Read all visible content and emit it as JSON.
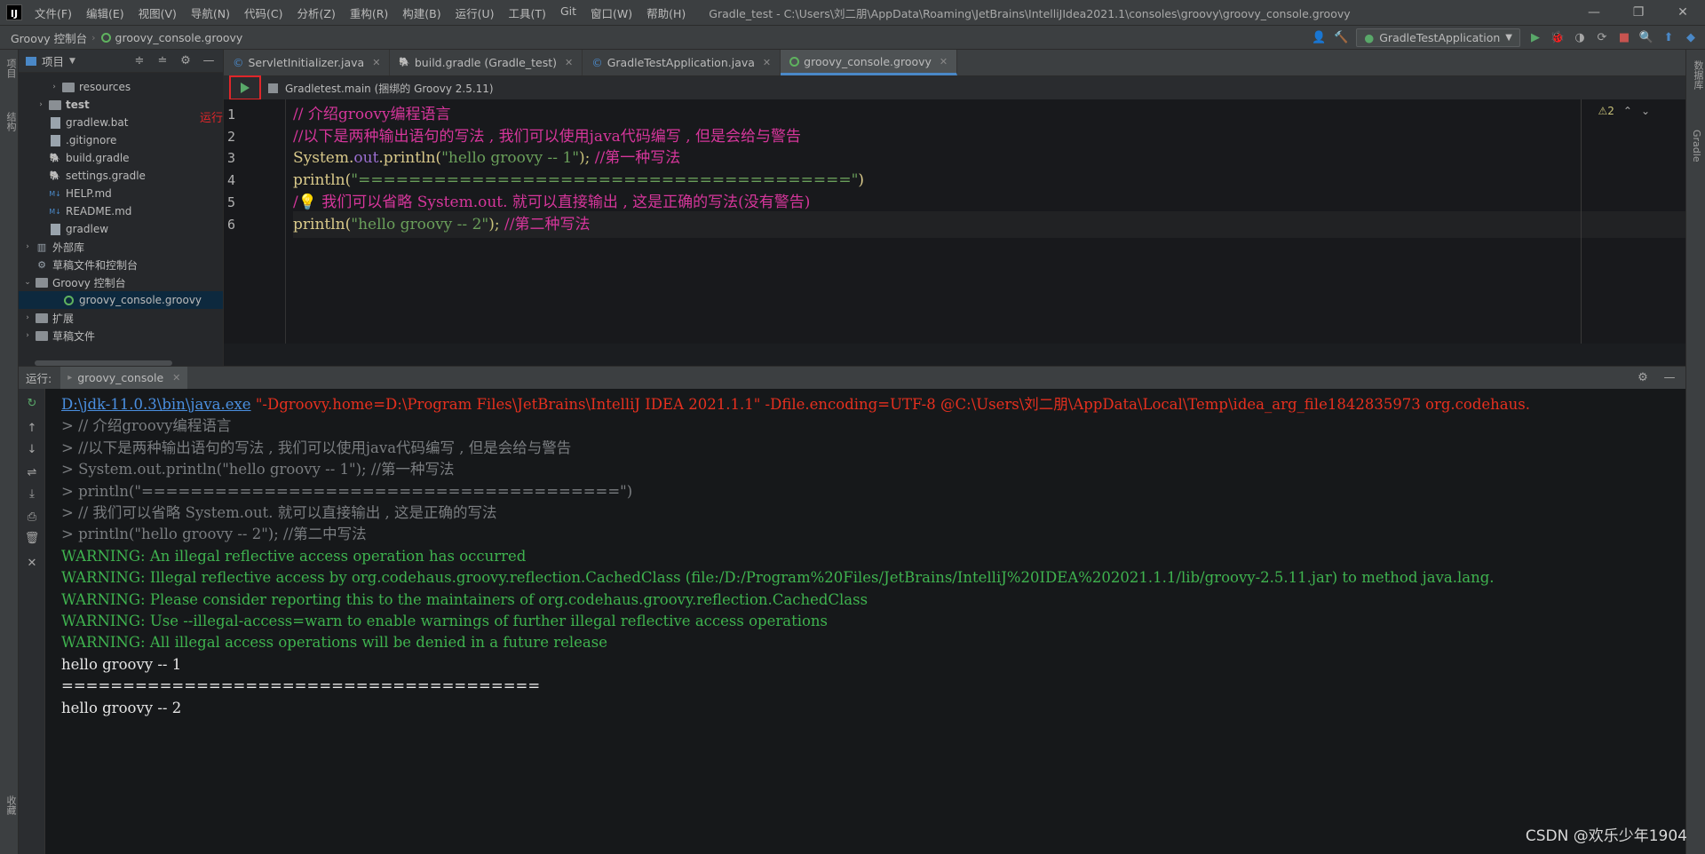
{
  "menu": {
    "items": [
      "文件(F)",
      "编辑(E)",
      "视图(V)",
      "导航(N)",
      "代码(C)",
      "分析(Z)",
      "重构(R)",
      "构建(B)",
      "运行(U)",
      "工具(T)",
      "Git",
      "窗口(W)",
      "帮助(H)"
    ],
    "window_title": "Gradle_test - C:\\Users\\刘二朋\\AppData\\Roaming\\JetBrains\\IntelliJIdea2021.1\\consoles\\groovy\\groovy_console.groovy"
  },
  "nav": {
    "crumb1": "Groovy 控制台",
    "crumb2": "groovy_console.groovy",
    "run_config": "GradleTestApplication"
  },
  "stripe": {
    "left_top": "项目",
    "left_mid": "结构",
    "left_bottom": "收藏",
    "right_top": "数据库",
    "right_mid": "Gradle"
  },
  "project": {
    "header_label": "项目",
    "tree": [
      {
        "label": "resources",
        "indent": 2,
        "arrow": "›",
        "icon": "folder"
      },
      {
        "label": "test",
        "indent": 1,
        "arrow": "›",
        "icon": "folder",
        "bold": true
      },
      {
        "label": "gradlew.bat",
        "indent": 1,
        "arrow": "",
        "icon": "file"
      },
      {
        "label": ".gitignore",
        "indent": 1,
        "arrow": "",
        "icon": "file"
      },
      {
        "label": "build.gradle",
        "indent": 1,
        "arrow": "",
        "icon": "gradle"
      },
      {
        "label": "settings.gradle",
        "indent": 1,
        "arrow": "",
        "icon": "gradle"
      },
      {
        "label": "HELP.md",
        "indent": 1,
        "arrow": "",
        "icon": "md"
      },
      {
        "label": "README.md",
        "indent": 1,
        "arrow": "",
        "icon": "md"
      },
      {
        "label": "gradlew",
        "indent": 1,
        "arrow": "",
        "icon": "file"
      },
      {
        "label": "外部库",
        "indent": 0,
        "arrow": "›",
        "icon": "lib"
      },
      {
        "label": "草稿文件和控制台",
        "indent": 0,
        "arrow": "",
        "icon": "scratch"
      },
      {
        "label": "Groovy 控制台",
        "indent": 0,
        "arrow": "⌄",
        "icon": "folder"
      },
      {
        "label": "groovy_console.groovy",
        "indent": 2,
        "arrow": "",
        "icon": "groovy",
        "selected": true
      },
      {
        "label": "扩展",
        "indent": 0,
        "arrow": "›",
        "icon": "folder"
      },
      {
        "label": "草稿文件",
        "indent": 0,
        "arrow": "›",
        "icon": "folder"
      }
    ]
  },
  "tabs": [
    {
      "label": "ServletInitializer.java",
      "icon": "java"
    },
    {
      "label": "build.gradle (Gradle_test)",
      "icon": "gradle"
    },
    {
      "label": "GradleTestApplication.java",
      "icon": "java"
    },
    {
      "label": "groovy_console.groovy",
      "icon": "groovy",
      "active": true
    }
  ],
  "editor": {
    "run_target": "Gradletest.main (捆绑的 Groovy 2.5.11)",
    "run_annotation": "运行",
    "warning_count": "⚠2",
    "lines": [
      [
        {
          "t": "// 介绍groovy编程语言",
          "c": "c-comment"
        }
      ],
      [
        {
          "t": "//以下是两种输出语句的写法 , 我们可以使用java代码编写 , 但是会给与警告",
          "c": "c-comment"
        }
      ],
      [
        {
          "t": "System.",
          "c": "c-plain"
        },
        {
          "t": "out",
          "c": "c-field"
        },
        {
          "t": ".println(",
          "c": "c-plain"
        },
        {
          "t": "\"hello groovy -- 1\"",
          "c": "c-string"
        },
        {
          "t": "); ",
          "c": "c-punct"
        },
        {
          "t": "//第一种写法",
          "c": "c-comment"
        }
      ],
      [
        {
          "t": "println(",
          "c": "c-plain"
        },
        {
          "t": "\"=======================================\"",
          "c": "c-string"
        },
        {
          "t": ")",
          "c": "c-plain"
        }
      ],
      [
        {
          "t": "/💡 我们可以省略 System.out. 就可以直接输出 , 这是正确的写法(没有警告)",
          "c": "c-comment"
        }
      ],
      [
        {
          "t": "println(",
          "c": "c-plain"
        },
        {
          "t": "\"hello groovy -- 2\"",
          "c": "c-string"
        },
        {
          "t": "); ",
          "c": "c-punct"
        },
        {
          "t": "//第二种写法",
          "c": "c-comment"
        }
      ]
    ]
  },
  "run": {
    "label": "运行:",
    "tab_label": "groovy_console",
    "console": [
      {
        "parts": [
          {
            "t": "D:\\jdk-11.0.3\\bin\\java.exe",
            "c": "con-cmd-link"
          },
          {
            "t": " \"-Dgroovy.home=D:\\Program Files\\JetBrains\\IntelliJ IDEA 2021.1.1\" -Dfile.encoding=UTF-8 @C:\\Users\\刘二朋\\AppData\\Local\\Temp\\idea_arg_file1842835973 org.codehaus.",
            "c": "con-cmd"
          }
        ]
      },
      {
        "parts": [
          {
            "t": "> // 介绍groovy编程语言",
            "c": "con-echo"
          }
        ]
      },
      {
        "parts": [
          {
            "t": "> //以下是两种输出语句的写法 , 我们可以使用java代码编写 , 但是会给与警告",
            "c": "con-echo"
          }
        ]
      },
      {
        "parts": [
          {
            "t": "> System.out.println(\"hello groovy -- 1\"); //第一种写法",
            "c": "con-echo"
          }
        ]
      },
      {
        "parts": [
          {
            "t": "> println(\"=======================================\")",
            "c": "con-echo"
          }
        ]
      },
      {
        "parts": [
          {
            "t": "> // 我们可以省略 System.out. 就可以直接输出 , 这是正确的写法",
            "c": "con-echo"
          }
        ]
      },
      {
        "parts": [
          {
            "t": "> println(\"hello groovy -- 2\"); //第二中写法",
            "c": "con-echo"
          }
        ]
      },
      {
        "parts": [
          {
            "t": "WARNING: An illegal reflective access operation has occurred",
            "c": "con-warn"
          }
        ]
      },
      {
        "parts": [
          {
            "t": "WARNING: Illegal reflective access by org.codehaus.groovy.reflection.CachedClass (file:/D:/Program%20Files/JetBrains/IntelliJ%20IDEA%202021.1.1/lib/groovy-2.5.11.jar) to method java.lang.",
            "c": "con-warn"
          }
        ]
      },
      {
        "parts": [
          {
            "t": "WARNING: Please consider reporting this to the maintainers of org.codehaus.groovy.reflection.CachedClass",
            "c": "con-warn"
          }
        ]
      },
      {
        "parts": [
          {
            "t": "WARNING: Use --illegal-access=warn to enable warnings of further illegal reflective access operations",
            "c": "con-warn"
          }
        ]
      },
      {
        "parts": [
          {
            "t": "WARNING: All illegal access operations will be denied in a future release",
            "c": "con-warn"
          }
        ]
      },
      {
        "parts": [
          {
            "t": "hello groovy -- 1",
            "c": "con-out"
          }
        ]
      },
      {
        "parts": [
          {
            "t": "=======================================",
            "c": "con-out"
          }
        ]
      },
      {
        "parts": [
          {
            "t": "hello groovy -- 2",
            "c": "con-out"
          }
        ]
      }
    ]
  },
  "watermark": "CSDN @欢乐少年1904"
}
